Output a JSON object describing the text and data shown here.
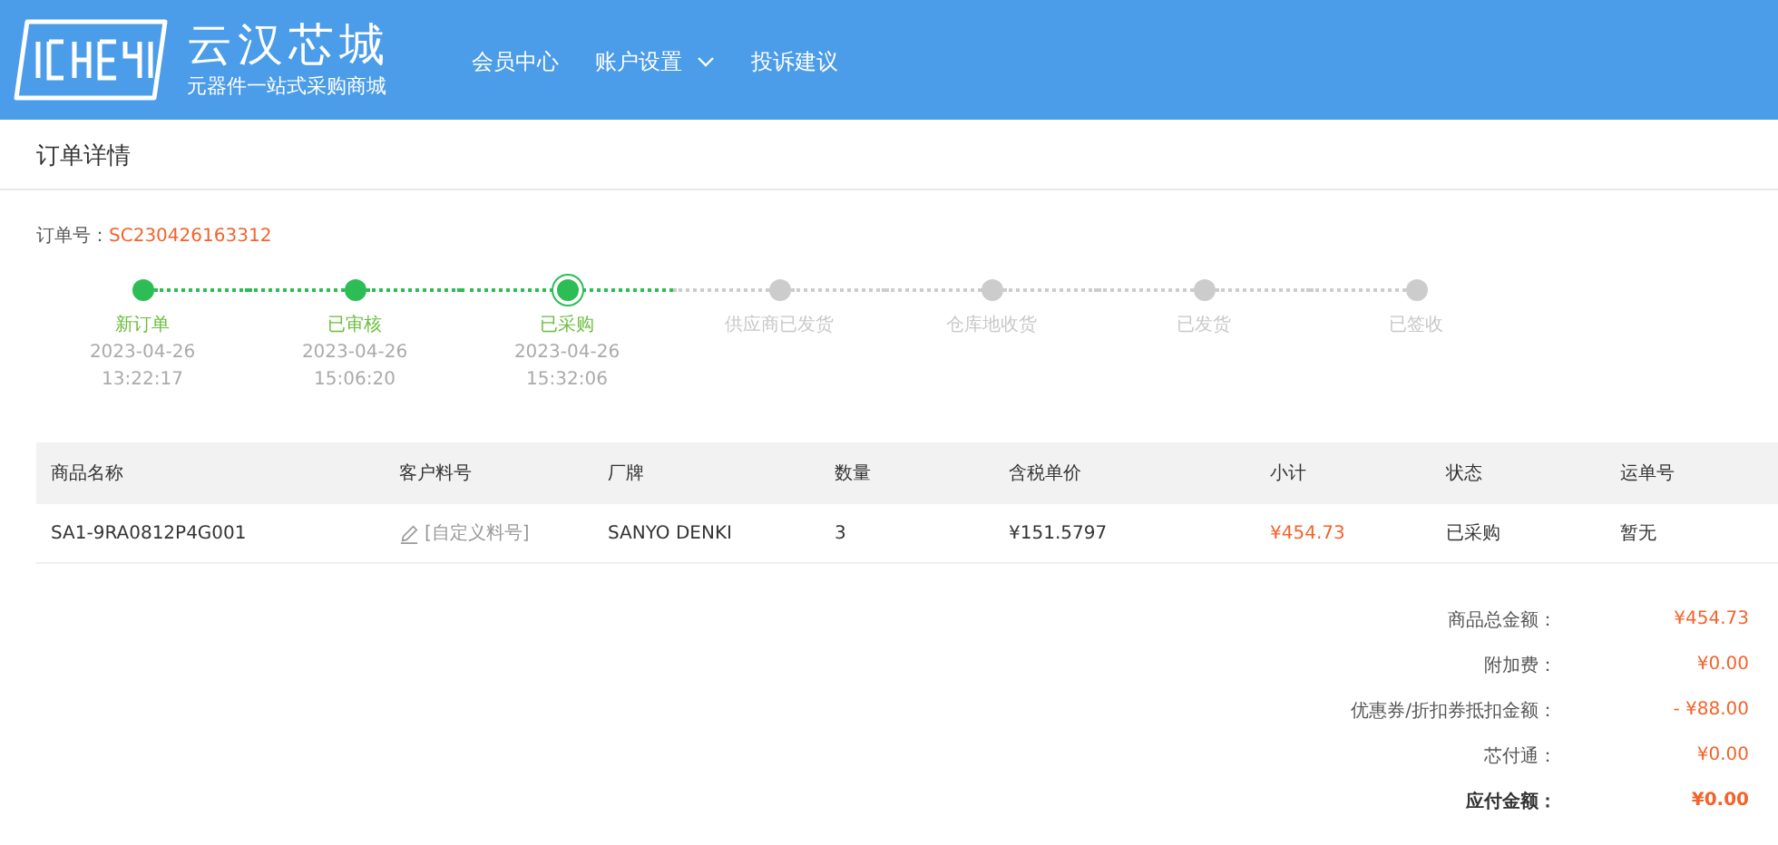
{
  "header": {
    "brand": "云汉芯城",
    "slogan": "元器件一站式采购商城",
    "nav": [
      {
        "label": "会员中心",
        "dropdown": false
      },
      {
        "label": "账户设置",
        "dropdown": true
      },
      {
        "label": "投诉建议",
        "dropdown": false
      }
    ]
  },
  "page_title": "订单详情",
  "order": {
    "label": "订单号：",
    "number": "SC230426163312"
  },
  "steps": [
    {
      "label": "新订单",
      "date": "2023-04-26",
      "time": "13:22:17",
      "reached": true,
      "current": false
    },
    {
      "label": "已审核",
      "date": "2023-04-26",
      "time": "15:06:20",
      "reached": true,
      "current": false
    },
    {
      "label": "已采购",
      "date": "2023-04-26",
      "time": "15:32:06",
      "reached": true,
      "current": true
    },
    {
      "label": "供应商已发货",
      "reached": false,
      "current": false
    },
    {
      "label": "仓库地收货",
      "reached": false,
      "current": false
    },
    {
      "label": "已发货",
      "reached": false,
      "current": false
    },
    {
      "label": "已签收",
      "reached": false,
      "current": false
    }
  ],
  "table": {
    "columns": [
      "商品名称",
      "客户料号",
      "厂牌",
      "数量",
      "含税单价",
      "小计",
      "状态",
      "运单号"
    ],
    "rows": [
      {
        "name": "SA1-9RA0812P4G001",
        "customer_part": "[自定义料号]",
        "brand": "SANYO DENKI",
        "qty": "3",
        "unit_price": "¥151.5797",
        "subtotal": "¥454.73",
        "status": "已采购",
        "tracking": "暂无"
      }
    ]
  },
  "totals": [
    {
      "label": "商品总金额：",
      "value": "¥454.73",
      "emphasis": false
    },
    {
      "label": "附加费：",
      "value": "¥0.00",
      "emphasis": false
    },
    {
      "label": "优惠券/折扣券抵扣金额：",
      "value": "- ¥88.00",
      "emphasis": false
    },
    {
      "label": "芯付通：",
      "value": "¥0.00",
      "emphasis": false
    },
    {
      "label": "应付金额：",
      "value": "¥0.00",
      "emphasis": true
    }
  ]
}
